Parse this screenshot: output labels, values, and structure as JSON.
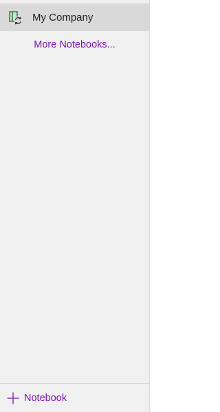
{
  "notebooks": {
    "items": [
      {
        "label": "My Company",
        "icon": "notebook-sync-icon"
      }
    ],
    "more_label": "More Notebooks..."
  },
  "footer": {
    "add_label": "Notebook",
    "icon": "plus-icon"
  },
  "colors": {
    "accent": "#7719aa",
    "notebook_icon": "#1e8b3a",
    "selected_bg": "#d9d9d9",
    "panel_bg": "#f0f0f0"
  }
}
